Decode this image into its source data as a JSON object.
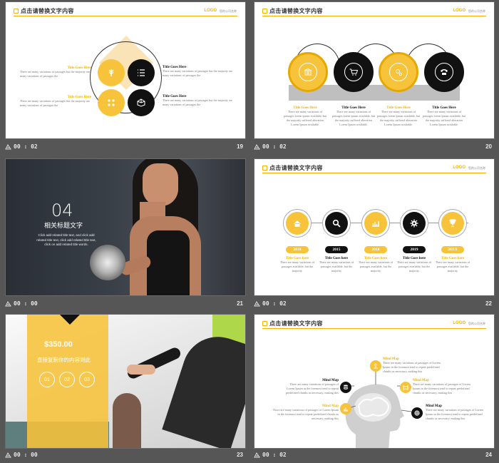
{
  "header": {
    "title": "点击请替换文字内容",
    "logo": "LOGO",
    "logo_sub": "您的公司名称"
  },
  "slides": [
    {
      "time": "00 : 02",
      "num": "19",
      "items": [
        {
          "title": "Title Goes Here",
          "text": "There are many variations of passages but the majority are many variations of passages the"
        },
        {
          "title": "Title Goes Here",
          "text": "There are many variations of passages but the majority are many variations of passages the"
        },
        {
          "title": "Title Goes Here",
          "text": "There are many variations of passages but the majority are many variations of passages the"
        },
        {
          "title": "Title Goes Here",
          "text": "There are many variations of passages but the majority are many variations of passages the"
        }
      ]
    },
    {
      "time": "00 : 02",
      "num": "20",
      "items": [
        {
          "title": "Title Goes Here",
          "text": "There are many variations of passages lorem ipsum available, but the majority suffered alteration Lorem Ipsum available."
        },
        {
          "title": "Title Goes Here",
          "text": "There are many variations of passages lorem ipsum available, but the majority suffered alteration Lorem Ipsum available."
        },
        {
          "title": "Title Goes Here",
          "text": "There are many variations of passages lorem ipsum available, but the majority suffered alteration Lorem Ipsum available."
        },
        {
          "title": "Title Goes Here",
          "text": "There are many variations of passages lorem ipsum available, but the majority suffered alteration Lorem Ipsum available."
        }
      ]
    },
    {
      "time": "00 : 00",
      "num": "21",
      "number": "04",
      "heading": "相关标题文字",
      "text": "Click add related title text, and click add related title text, click add related title text, click on add related title words."
    },
    {
      "time": "00 : 02",
      "num": "22",
      "years": [
        "2010",
        "2015",
        "2018",
        "2019",
        "20XX"
      ],
      "items": [
        {
          "title": "Title Goes here",
          "text": "There are many variations of passages available, but the majority"
        },
        {
          "title": "Title Goes here",
          "text": "There are many variations of passages available, but the majority"
        },
        {
          "title": "Title Goes here",
          "text": "There are many variations of passages available, but the majority"
        },
        {
          "title": "Title Goes here",
          "text": "There are many variations of passages available, but the majority"
        },
        {
          "title": "Title Goes here",
          "text": "There are many variations of passages available, but the majority"
        }
      ]
    },
    {
      "time": "00 : 00",
      "num": "23",
      "price": "$350.00",
      "subtitle": "直接复制你的内容到此",
      "steps": [
        "01",
        "02",
        "03"
      ]
    },
    {
      "time": "00 : 02",
      "num": "24",
      "items": [
        {
          "title": "Mind Map",
          "text": "There are many variations of passages of Lorem Ipsum in the foremost tend to repeat predefined chunks as necessary, making this"
        },
        {
          "title": "Mind Map",
          "text": "There are many variations of passages of Lorem Ipsum in the foremost tend to repeat predefined chunks as necessary, making this"
        },
        {
          "title": "Mind Map",
          "text": "There are many variations of passages of Lorem Ipsum in the foremost tend to repeat predefined chunks as necessary, making this"
        },
        {
          "title": "Mind Map",
          "text": "There are many variations of passages of Lorem Ipsum in the foremost tend to repeat predefined chunks as necessary, making this"
        },
        {
          "title": "Mind Map",
          "text": "There are many variations of passages of Lorem Ipsum in the foremost tend to repeat predefined chunks as necessary, making this"
        }
      ]
    }
  ],
  "colors": {
    "accent": "#f7c33a",
    "dark": "#111111",
    "background": "#565656"
  }
}
